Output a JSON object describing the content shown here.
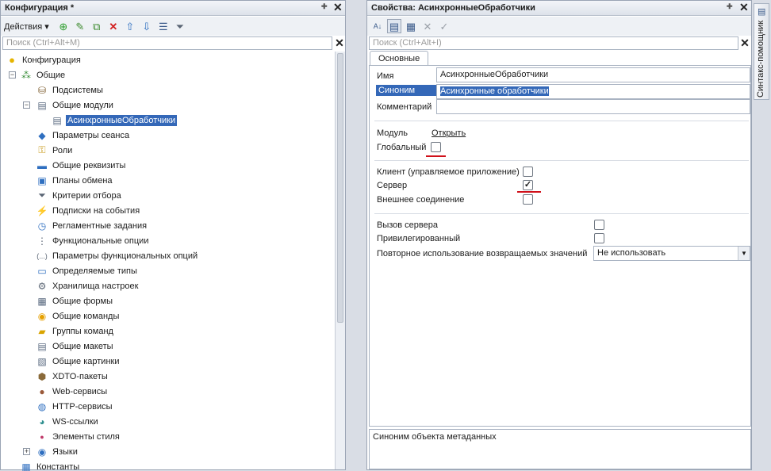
{
  "left_panel": {
    "title": "Конфигурация *",
    "actions_label": "Действия",
    "search_placeholder": "Поиск (Ctrl+Alt+M)",
    "tree": [
      {
        "label": "Конфигурация",
        "icon": "configuration-icon"
      },
      {
        "label": "Общие",
        "icon": "common-icon"
      },
      {
        "label": "Подсистемы",
        "icon": "subsystems-icon"
      },
      {
        "label": "Общие модули",
        "icon": "common-modules-icon"
      },
      {
        "label": "АсинхронныеОбработчики",
        "icon": "module-icon"
      },
      {
        "label": "Параметры сеанса",
        "icon": "session-params-icon"
      },
      {
        "label": "Роли",
        "icon": "roles-icon"
      },
      {
        "label": "Общие реквизиты",
        "icon": "common-attributes-icon"
      },
      {
        "label": "Планы обмена",
        "icon": "exchange-plans-icon"
      },
      {
        "label": "Критерии отбора",
        "icon": "filter-criteria-icon"
      },
      {
        "label": "Подписки на события",
        "icon": "event-subscriptions-icon"
      },
      {
        "label": "Регламентные задания",
        "icon": "scheduled-jobs-icon"
      },
      {
        "label": "Функциональные опции",
        "icon": "functional-options-icon"
      },
      {
        "label": "Параметры функциональных опций",
        "icon": "functional-option-params-icon"
      },
      {
        "label": "Определяемые типы",
        "icon": "defined-types-icon"
      },
      {
        "label": "Хранилища настроек",
        "icon": "settings-storages-icon"
      },
      {
        "label": "Общие формы",
        "icon": "common-forms-icon"
      },
      {
        "label": "Общие команды",
        "icon": "common-commands-icon"
      },
      {
        "label": "Группы команд",
        "icon": "command-groups-icon"
      },
      {
        "label": "Общие макеты",
        "icon": "common-templates-icon"
      },
      {
        "label": "Общие картинки",
        "icon": "common-pictures-icon"
      },
      {
        "label": "XDTO-пакеты",
        "icon": "xdto-packages-icon"
      },
      {
        "label": "Web-сервисы",
        "icon": "web-services-icon"
      },
      {
        "label": "HTTP-сервисы",
        "icon": "http-services-icon"
      },
      {
        "label": "WS-ссылки",
        "icon": "ws-references-icon"
      },
      {
        "label": "Элементы стиля",
        "icon": "style-items-icon"
      },
      {
        "label": "Языки",
        "icon": "languages-icon"
      },
      {
        "label": "Константы",
        "icon": "constants-icon"
      }
    ]
  },
  "right_panel": {
    "title": "Свойства: АсинхронныеОбработчики",
    "search_placeholder": "Поиск (Ctrl+Alt+I)",
    "tab_label": "Основные",
    "fields": {
      "name_label": "Имя",
      "name_value": "АсинхронныеОбработчики",
      "synonym_label": "Синоним",
      "synonym_value": "Асинхронные обработчики",
      "comment_label": "Комментарий",
      "comment_value": "",
      "module_label": "Модуль",
      "module_link": "Открыть",
      "global_label": "Глобальный",
      "global_checked": false,
      "client_label": "Клиент (управляемое приложение)",
      "client_checked": false,
      "server_label": "Сервер",
      "server_checked": true,
      "external_label": "Внешнее соединение",
      "external_checked": false,
      "server_call_label": "Вызов сервера",
      "server_call_checked": false,
      "privileged_label": "Привилегированный",
      "privileged_checked": false,
      "reuse_label": "Повторное использование возвращаемых значений",
      "reuse_value": "Не использовать"
    },
    "description": "Синоним объекта метаданных"
  },
  "side_tab": {
    "label": "Синтакс-помощник"
  },
  "colors": {
    "selection": "#3468b8",
    "annotation_red": "#d0101a"
  }
}
